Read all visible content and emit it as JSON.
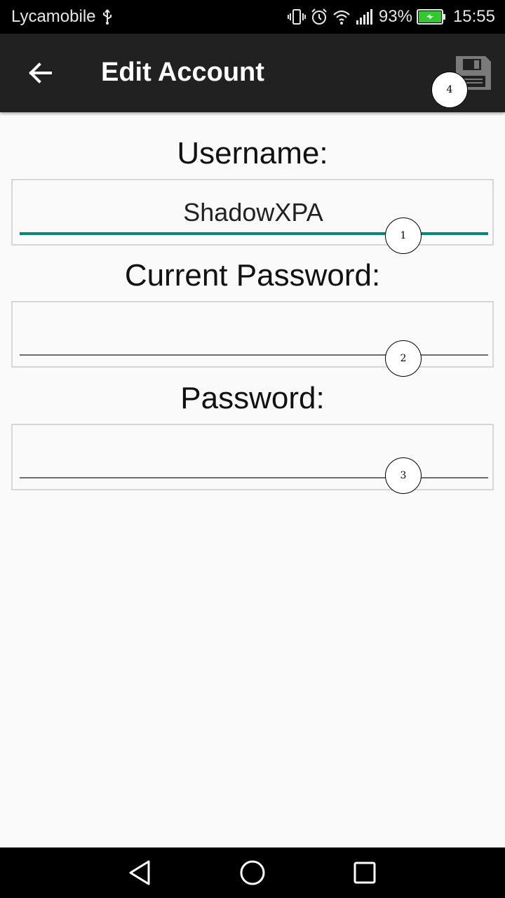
{
  "status_bar": {
    "carrier": "Lycamobile",
    "battery_percent": "93%",
    "time": "15:55",
    "icons": [
      "usb-icon",
      "vibrate-icon",
      "alarm-icon",
      "wifi-icon",
      "signal-icon",
      "battery-charging-icon"
    ]
  },
  "app_bar": {
    "title": "Edit Account",
    "back_icon": "arrow-left-icon",
    "save_icon": "floppy-disk-icon"
  },
  "form": {
    "username": {
      "label": "Username:",
      "value": "ShadowXPA"
    },
    "current_password": {
      "label": "Current Password:",
      "value": ""
    },
    "password": {
      "label": "Password:",
      "value": ""
    }
  },
  "markers": [
    "1",
    "2",
    "3",
    "4"
  ],
  "nav_bar": {
    "icons": [
      "back-triangle-icon",
      "home-circle-icon",
      "recents-square-icon"
    ]
  },
  "colors": {
    "accent": "#00897b",
    "app_bar": "#212121",
    "background": "#fafafa"
  }
}
